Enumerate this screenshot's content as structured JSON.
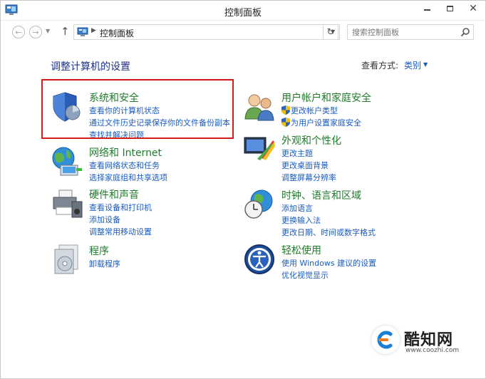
{
  "window": {
    "title": "控制面板"
  },
  "nav": {
    "address_text": "控制面板",
    "search_placeholder": "搜索控制面板"
  },
  "header": {
    "heading": "调整计算机的设置",
    "view_by_label": "查看方式:",
    "view_by_value": "类别"
  },
  "categories": {
    "security": {
      "title": "系统和安全",
      "links": [
        "查看你的计算机状态",
        "通过文件历史记录保存你的文件备份副本",
        "查找并解决问题"
      ]
    },
    "network": {
      "title": "网络和 Internet",
      "links": [
        "查看网络状态和任务",
        "选择家庭组和共享选项"
      ]
    },
    "hardware": {
      "title": "硬件和声音",
      "links": [
        "查看设备和打印机",
        "添加设备",
        "调整常用移动设置"
      ]
    },
    "programs": {
      "title": "程序",
      "links": [
        "卸载程序"
      ]
    },
    "users": {
      "title": "用户帐户和家庭安全",
      "links": [
        "更改帐户类型",
        "为用户设置家庭安全"
      ]
    },
    "appearance": {
      "title": "外观和个性化",
      "links": [
        "更改主题",
        "更改桌面背景",
        "调整屏幕分辨率"
      ]
    },
    "clock": {
      "title": "时钟、语言和区域",
      "links": [
        "添加语言",
        "更换输入法",
        "更改日期、时间或数字格式"
      ]
    },
    "ease": {
      "title": "轻松使用",
      "links": [
        "使用 Windows 建议的设置",
        "优化视觉显示"
      ]
    }
  },
  "watermark": {
    "brand": "酷知网",
    "url": "www.coozhi.com"
  },
  "colors": {
    "category_title": "#1f7b2a",
    "link": "#1a5bbf",
    "heading": "#1e3287",
    "highlight": "#d51a1a"
  }
}
